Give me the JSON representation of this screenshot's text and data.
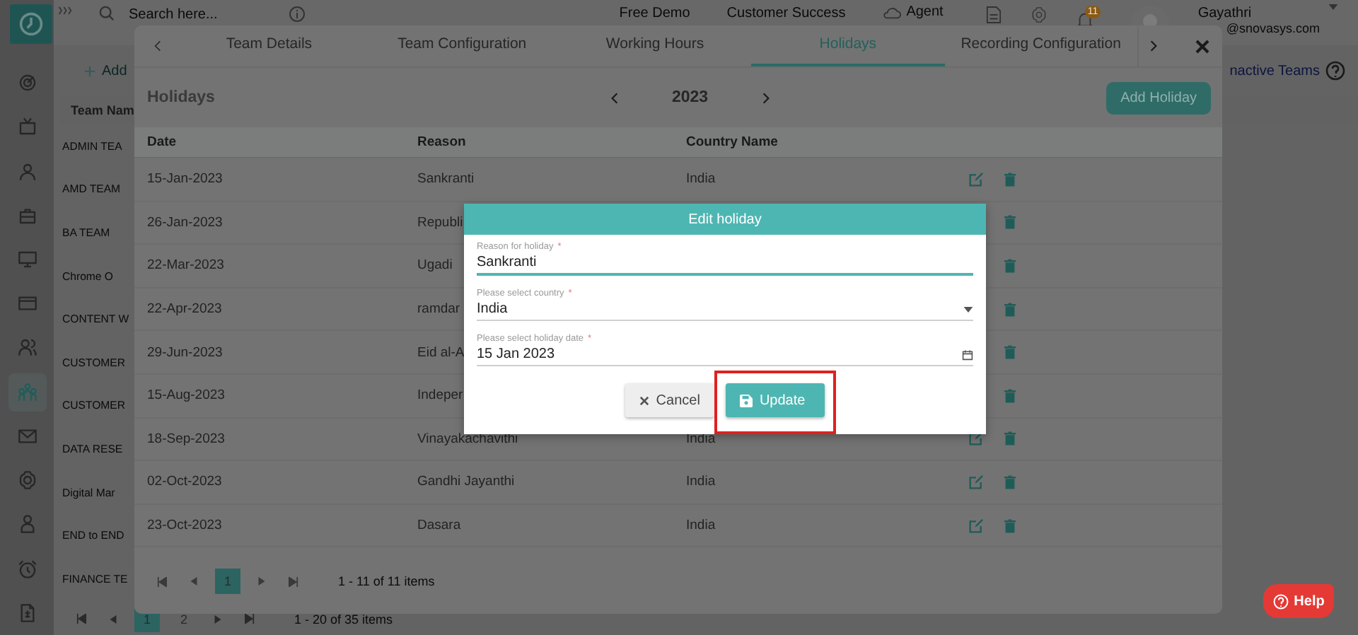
{
  "app": {
    "sidebar": {
      "items": [
        {
          "kind": "target",
          "selected": false
        },
        {
          "kind": "tv",
          "selected": false
        },
        {
          "kind": "person",
          "selected": false
        },
        {
          "kind": "briefcase",
          "selected": false
        },
        {
          "kind": "monitor",
          "selected": false
        },
        {
          "kind": "card",
          "selected": false
        },
        {
          "kind": "people",
          "selected": false
        },
        {
          "kind": "team",
          "selected": true
        },
        {
          "kind": "mail",
          "selected": false
        },
        {
          "kind": "gear",
          "selected": false
        },
        {
          "kind": "user",
          "selected": false
        },
        {
          "kind": "alarm",
          "selected": false
        },
        {
          "kind": "invoice",
          "selected": false
        }
      ]
    },
    "top_bar": {
      "search_placeholder": "Search here...",
      "links": [
        "Free Demo",
        "Customer Success"
      ],
      "agent": "Agent",
      "notification_count": "11",
      "user_name": "Gayathri",
      "user_email": "@snovasys.com"
    },
    "teams_panel": {
      "add_label": "Add",
      "inactive_link": "nactive Teams",
      "column": "Team Nam",
      "rows": [
        "ADMIN TEA",
        "AMD TEAM",
        "BA TEAM",
        "Chrome O",
        "CONTENT W",
        "CUSTOMER",
        "CUSTOMER",
        "DATA RESE",
        "Digital Mar",
        "END to END",
        "FINANCE TE"
      ],
      "pager": {
        "pages": [
          {
            "label": "1",
            "selected": true
          },
          {
            "label": "2",
            "selected": false
          }
        ],
        "summary": "1 - 20 of 35 items"
      }
    }
  },
  "team_dialog": {
    "tabs": [
      {
        "label": "Team Details",
        "selected": false
      },
      {
        "label": "Team Configuration",
        "selected": false
      },
      {
        "label": "Working Hours",
        "selected": false
      },
      {
        "label": "Holidays",
        "selected": true
      },
      {
        "label": "Recording Configuration",
        "selected": false
      }
    ],
    "section_title": "Holidays",
    "year": "2023",
    "add_button": "Add Holiday",
    "columns": [
      "Date",
      "Reason",
      "Country Name"
    ],
    "rows": [
      {
        "date": "15-Jan-2023",
        "reason": "Sankranti",
        "country": "India"
      },
      {
        "date": "26-Jan-2023",
        "reason": "Republi"
      },
      {
        "date": "22-Mar-2023",
        "reason": "Ugadi"
      },
      {
        "date": "22-Apr-2023",
        "reason": "ramdar"
      },
      {
        "date": "29-Jun-2023",
        "reason": "Eid al-A"
      },
      {
        "date": "15-Aug-2023",
        "reason": "Indeper"
      },
      {
        "date": "18-Sep-2023",
        "reason": "Vinayakachavithi",
        "country": "India"
      },
      {
        "date": "02-Oct-2023",
        "reason": "Gandhi Jayanthi",
        "country": "India"
      },
      {
        "date": "23-Oct-2023",
        "reason": "Dasara",
        "country": "India"
      }
    ],
    "pager": {
      "pages": [
        {
          "label": "1",
          "selected": true
        }
      ],
      "summary": "1 - 11 of 11 items"
    }
  },
  "edit_dialog": {
    "title": "Edit holiday",
    "fields": [
      {
        "kind": "text",
        "label": "Reason for holiday",
        "required_mark": "*",
        "value": "Sankranti",
        "focused": true
      },
      {
        "kind": "select",
        "label": "Please select country",
        "required_mark": "*",
        "value": "India",
        "focused": false
      },
      {
        "kind": "date",
        "label": "Please select holiday date",
        "required_mark": "*",
        "value": "15 Jan 2023",
        "focused": false
      }
    ],
    "buttons": [
      {
        "kind": "cancel",
        "label": "Cancel",
        "highlighted": false
      },
      {
        "kind": "update",
        "label": "Update",
        "highlighted": true
      }
    ]
  },
  "help_button": {
    "label": "Help"
  }
}
